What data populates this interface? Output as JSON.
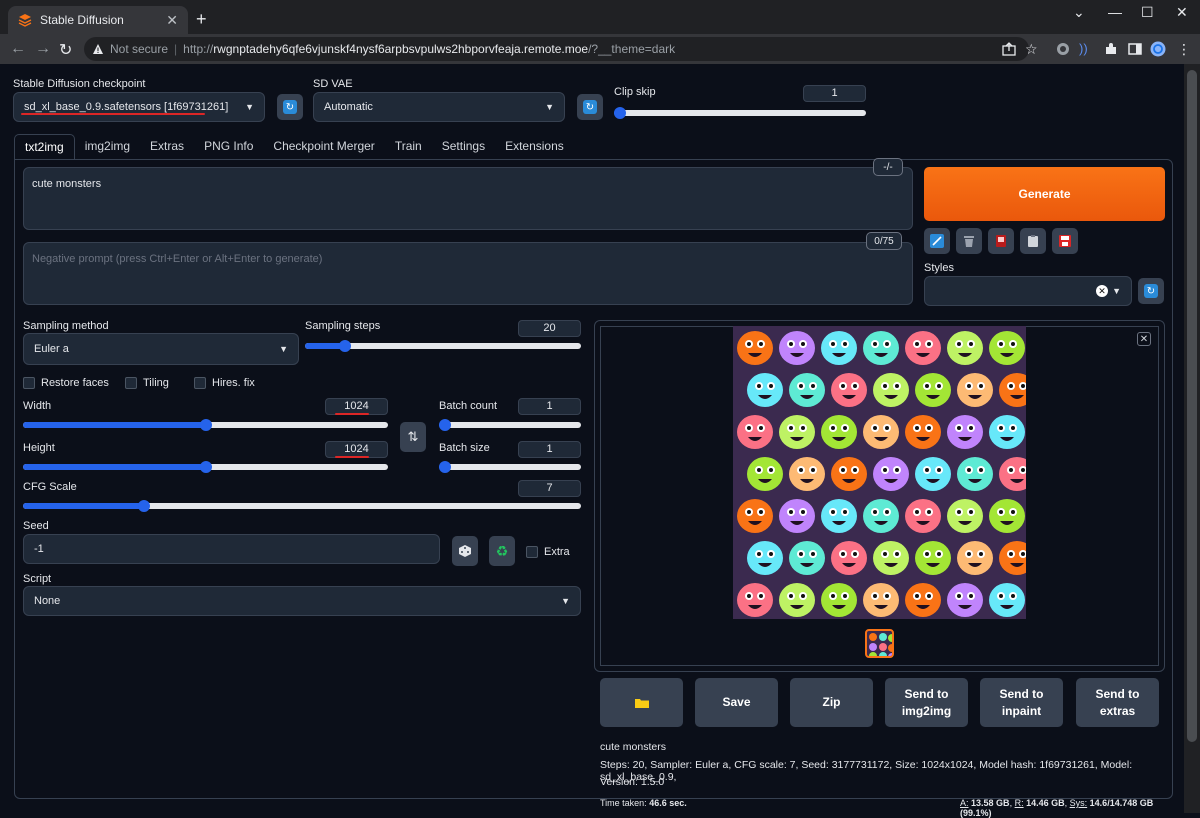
{
  "browser": {
    "tab_title": "Stable Diffusion",
    "not_secure": "Not secure",
    "url_scheme": "http://",
    "url_host": "rwgnptadehy6qfe6vjunskf4nysf6arpbsvpulws2hbporvfeaja.remote.moe",
    "url_path": "/?__theme=dark"
  },
  "top": {
    "checkpoint_label": "Stable Diffusion checkpoint",
    "checkpoint_value": "sd_xl_base_0.9.safetensors [1f69731261]",
    "vae_label": "SD VAE",
    "vae_value": "Automatic",
    "clip_label": "Clip skip",
    "clip_value": "1"
  },
  "tabs": [
    "txt2img",
    "img2img",
    "Extras",
    "PNG Info",
    "Checkpoint Merger",
    "Train",
    "Settings",
    "Extensions"
  ],
  "prompt": {
    "text": "cute monsters",
    "token_count": "-/-",
    "negative_placeholder": "Negative prompt (press Ctrl+Enter or Alt+Enter to generate)",
    "negative_count": "0/75"
  },
  "generate": {
    "label": "Generate",
    "styles_label": "Styles"
  },
  "params": {
    "sampling_method_label": "Sampling method",
    "sampling_method_value": "Euler a",
    "sampling_steps_label": "Sampling steps",
    "sampling_steps_value": "20",
    "restore_faces": "Restore faces",
    "tiling": "Tiling",
    "hires_fix": "Hires. fix",
    "width_label": "Width",
    "width_value": "1024",
    "height_label": "Height",
    "height_value": "1024",
    "batch_count_label": "Batch count",
    "batch_count_value": "1",
    "batch_size_label": "Batch size",
    "batch_size_value": "1",
    "cfg_label": "CFG Scale",
    "cfg_value": "7",
    "seed_label": "Seed",
    "seed_value": "-1",
    "extra_label": "Extra",
    "script_label": "Script",
    "script_value": "None"
  },
  "slider_levels": {
    "clip_skip": 0,
    "sampling_steps": 0.13,
    "width": 0.5,
    "height": 0.5,
    "batch_count": 0,
    "batch_size": 0,
    "cfg": 0.21
  },
  "actions": {
    "folder_icon": "folder-icon",
    "save": "Save",
    "zip": "Zip",
    "send_img2img_1": "Send to",
    "send_img2img_2": "img2img",
    "send_inpaint_1": "Send to",
    "send_inpaint_2": "inpaint",
    "send_extras_1": "Send to",
    "send_extras_2": "extras"
  },
  "output_info": {
    "prompt": "cute monsters",
    "params_line1": "Steps: 20, Sampler: Euler a, CFG scale: 7, Seed: 3177731172, Size: 1024x1024, Model hash: 1f69731261, Model: sd_xl_base_0.9,",
    "params_line2": "Version: 1.5.0",
    "time_label": "Time taken:",
    "time_value": "46.6 sec.",
    "mem_a_label": "A:",
    "mem_a": "13.58 GB",
    "mem_r_label": "R:",
    "mem_r": "14.46 GB",
    "mem_sys_label": "Sys:",
    "mem_sys": "14.6/14.748 GB (99.1%)"
  },
  "colors": {
    "accent": "#2563eb",
    "generate": "#f97316",
    "background": "#0b0f19",
    "panel": "#1f2937",
    "highlight_underline": "#dc2626"
  }
}
